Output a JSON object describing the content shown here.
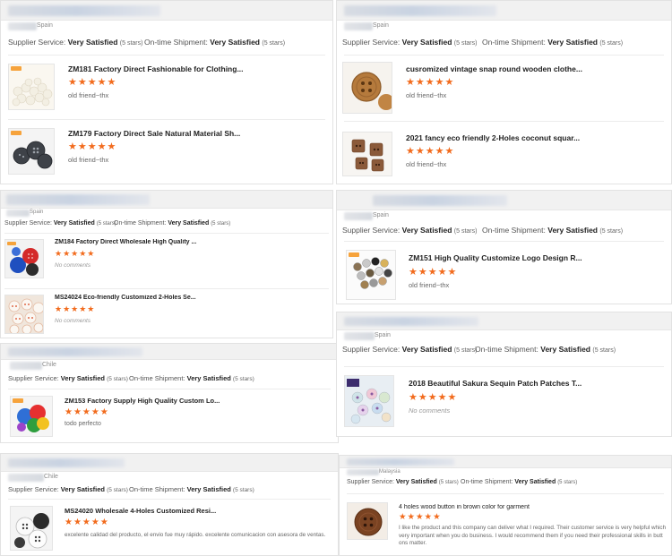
{
  "labels": {
    "supplier_service": "Supplier Service:",
    "on_time": "On-time Shipment:",
    "rating_value": "Very Satisfied",
    "stars_count": "(5 stars)",
    "stars": "★★★★★"
  },
  "cards": [
    {
      "country": "Spain",
      "items": [
        {
          "title": "ZM181 Factory Direct Fashionable for Clothing...",
          "comment": "old friend~thx"
        },
        {
          "title": "ZM179 Factory Direct Sale Natural Material Sh...",
          "comment": "old friend~thx"
        }
      ]
    },
    {
      "country": "Spain",
      "items": [
        {
          "title": "cusromized vintage snap round wooden clothe...",
          "comment": "old friend~thx"
        },
        {
          "title": "2021 fancy eco friendly 2-Holes coconut squar...",
          "comment": "old friend~thx"
        }
      ]
    },
    {
      "country": "Spain",
      "items": [
        {
          "title": "ZM184 Factory Direct Wholesale High Quality ...",
          "comment": "No comments"
        },
        {
          "title": "MS24024 Eco-friendly Customized 2-Holes Se...",
          "comment": "No comments"
        }
      ]
    },
    {
      "country": "Spain",
      "items": [
        {
          "title": "ZM151 High Quality Customize Logo Design R...",
          "comment": "old friend~thx"
        }
      ]
    },
    {
      "country": "Chile",
      "items": [
        {
          "title": "ZM153 Factory Supply High Quality Custom Lo...",
          "comment": "todo perfecto"
        }
      ]
    },
    {
      "country": "Spain",
      "items": [
        {
          "title": "2018 Beautiful Sakura Sequin Patch Patches T...",
          "comment": "No comments"
        }
      ]
    },
    {
      "country": "Chile",
      "items": [
        {
          "title": "MS24020 Wholesale 4-Holes Customized Resi...",
          "comment": "excelente calidad del producto, el envio fue muy rápido. excelente comunicacion con asesora de ventas."
        }
      ]
    },
    {
      "country": "Malaysia",
      "items": [
        {
          "title": "4 holes wood button in brown color for garment",
          "comment": "I like the product and this company can deliver what I required. Their customer service is very helpful which very important when you do business. I would recommend them if you need their professional skills in butt ons matter."
        }
      ]
    }
  ]
}
